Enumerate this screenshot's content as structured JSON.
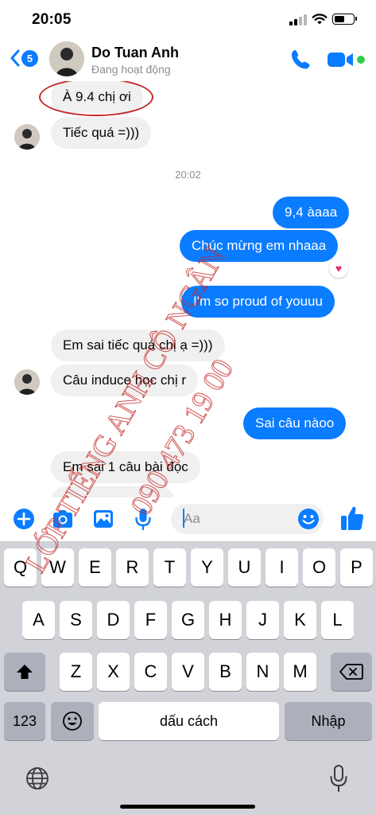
{
  "status_bar": {
    "time": "20:05"
  },
  "header": {
    "back_badge": "5",
    "contact_name": "Do Tuan Anh",
    "contact_status": "Đang hoạt động"
  },
  "chat": {
    "messages": [
      {
        "side": "in",
        "text": "À 9.4 chị ơi"
      },
      {
        "side": "in",
        "text": "Tiếc quá =)))"
      },
      {
        "side": "out",
        "text": "9,4 àaaa"
      },
      {
        "side": "out",
        "text": "Chúc mừng em nhaaa"
      },
      {
        "side": "out",
        "text": "I'm so proud of youuu"
      },
      {
        "side": "in",
        "text": "Em sai tiếc quá chị ạ =)))"
      },
      {
        "side": "in",
        "text": "Câu induce học chị r"
      },
      {
        "side": "out",
        "text": "Sai câu nàoo"
      },
      {
        "side": "in",
        "text": "Em sai 1 câu bài đọc"
      }
    ],
    "timestamp": "20:02",
    "reaction": "heart"
  },
  "composer": {
    "placeholder": "Aa"
  },
  "keyboard": {
    "row1": [
      "Q",
      "W",
      "E",
      "R",
      "T",
      "Y",
      "U",
      "I",
      "O",
      "P"
    ],
    "row2": [
      "A",
      "S",
      "D",
      "F",
      "G",
      "H",
      "J",
      "K",
      "L"
    ],
    "row3": [
      "Z",
      "X",
      "C",
      "V",
      "B",
      "N",
      "M"
    ],
    "numbers_key": "123",
    "space_key": "dấu cách",
    "return_key": "Nhập"
  },
  "watermark": {
    "line1": "LỚP TIẾNG ANH CÔ NGÂN",
    "line2": "090 473 19 00"
  },
  "colors": {
    "messenger_blue": "#0a7cff",
    "incoming_bubble": "#f0f0f0",
    "online_green": "#31cc46",
    "watermark_red": "#c62828",
    "keyboard_bg": "#d1d3d9"
  }
}
